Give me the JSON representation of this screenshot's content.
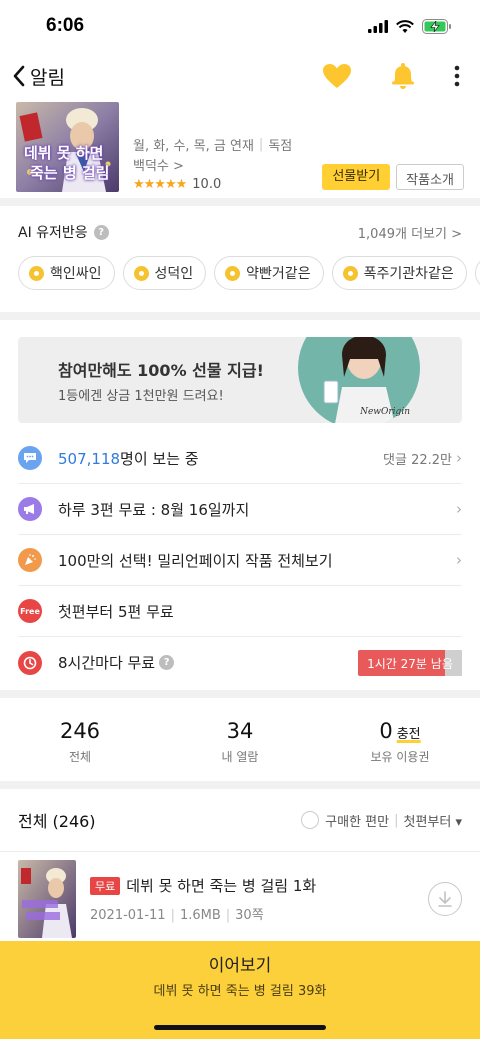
{
  "status": {
    "time": "6:06"
  },
  "nav": {
    "back_label": "알림"
  },
  "work": {
    "cover_title_line1": "데뷔 못 하면",
    "cover_title_line2": "죽는 병 걸림",
    "schedule": "월, 화, 수, 목, 금 연재",
    "exclusive": "독점",
    "author": "백덕수 >",
    "stars": "★★★★★",
    "rating": "10.0",
    "gift_button": "선물받기",
    "intro_button": "작품소개"
  },
  "ai": {
    "title": "AI 유저반응",
    "help": "?",
    "more": "1,049개 더보기 >",
    "tags": [
      "핵인싸인",
      "성덕인",
      "약빤거같은",
      "폭주기관차같은"
    ]
  },
  "banner": {
    "title": "참여만해도 100% 선물 지급!",
    "subtitle": "1등에겐 상금 1천만원 드려요!",
    "brand": "NewOrigin"
  },
  "info": {
    "viewers_count": "507,118",
    "viewers_suffix": "명이 보는 중",
    "comments": "댓글 22.2만",
    "daily_free": "하루 3편 무료 : 8월 16일까지",
    "million_pick": "100만의 선택! 밀리언페이지 작품 전체보기",
    "free_from_first": "첫편부터 5편 무료",
    "free_icon_text": "Free",
    "wait_free": "8시간마다 무료",
    "wait_free_progress": 0.84,
    "timer": "1시간 27분 남음"
  },
  "stats": {
    "total_num": "246",
    "total_label": "전체",
    "viewed_num": "34",
    "viewed_label": "내 열람",
    "owned_num": "0",
    "charge": "충전",
    "owned_label": "보유 이용권"
  },
  "list": {
    "title": "전체 (246)",
    "purchased_filter": "구매한 편만",
    "sort": "첫편부터 ▾"
  },
  "episodes": [
    {
      "badge": "무료",
      "title": "데뷔 못 하면 죽는 병 걸림 1화",
      "date": "2021-01-11",
      "size": "1.6MB",
      "pages": "30쪽"
    }
  ],
  "continue": {
    "title": "이어보기",
    "subtitle": "데뷔 못 하면 죽는 병 걸림 39화"
  },
  "colors": {
    "accent_yellow": "#fbd03b",
    "free_red": "#e84545",
    "link_blue": "#2f7bdf"
  }
}
